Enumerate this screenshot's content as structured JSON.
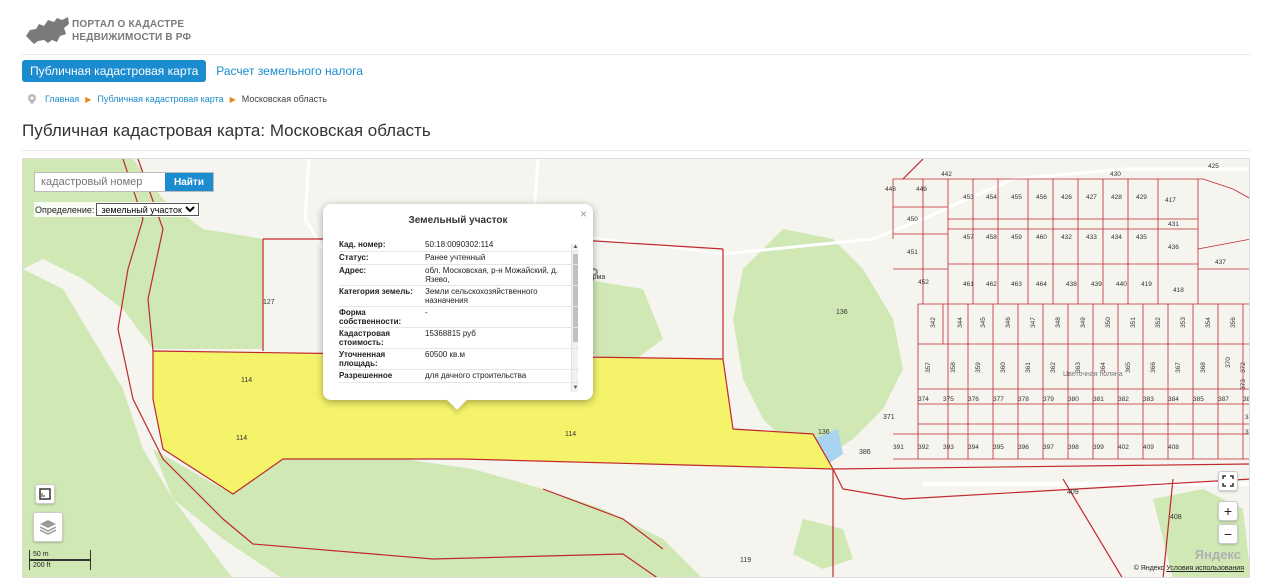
{
  "header": {
    "logo_line1": "ПОРТАЛ О КАДАСТРЕ",
    "logo_line2": "НЕДВИЖИМОСТИ В РФ",
    "tab_active": "Публичная кадастровая карта",
    "tab_other": "Расчет земельного налога"
  },
  "breadcrumbs": [
    "Главная",
    "Публичная кадастровая карта",
    "Московская область"
  ],
  "page_title": "Публичная кадастровая карта: Московская область",
  "map": {
    "search_placeholder": "кадастровый номер",
    "search_button": "Найти",
    "definition_label": "Определение:",
    "definition_value": "земельный участок",
    "scale_m": "50 m",
    "scale_ft": "200 ft",
    "copyright": "© Яндекс",
    "terms": "Условия использования",
    "brand": "Яндекс",
    "poi_label": "ферма",
    "area_label": "Цветочная поляна",
    "zoom_in": "+",
    "zoom_out": "−",
    "parcel_labels": [
      "127",
      "114",
      "114",
      "114",
      "136",
      "136",
      "119",
      "409",
      "408",
      "386",
      "371"
    ],
    "lot_numbers": [
      "448",
      "449",
      "453",
      "454",
      "455",
      "456",
      "426",
      "427",
      "428",
      "429",
      "417",
      "425",
      "430",
      "442",
      "450",
      "457",
      "458",
      "459",
      "460",
      "432",
      "433",
      "434",
      "435",
      "431",
      "436",
      "437",
      "451",
      "452",
      "461",
      "462",
      "463",
      "464",
      "438",
      "439",
      "440",
      "419",
      "418",
      "342",
      "344",
      "345",
      "346",
      "347",
      "348",
      "349",
      "350",
      "351",
      "352",
      "353",
      "354",
      "356",
      "357",
      "358",
      "359",
      "360",
      "361",
      "362",
      "363",
      "364",
      "365",
      "366",
      "367",
      "368",
      "370",
      "372",
      "373",
      "374",
      "375",
      "376",
      "377",
      "378",
      "379",
      "380",
      "381",
      "382",
      "383",
      "384",
      "385",
      "387",
      "388",
      "389",
      "390",
      "391",
      "392",
      "393",
      "394",
      "395",
      "396",
      "397",
      "398",
      "399",
      "402",
      "409",
      "408"
    ]
  },
  "popup": {
    "title": "Земельный участок",
    "close": "×",
    "rows": [
      {
        "k": "Кад. номер:",
        "v": "50:18:0090302:114"
      },
      {
        "k": "Статус:",
        "v": "Ранее учтенный"
      },
      {
        "k": "Адрес:",
        "v": "обл. Московская, р-н Можайский, д. Язево,"
      },
      {
        "k": "Категория земель:",
        "v": "Земли сельскохозяйственного назначения"
      },
      {
        "k": "Форма собственности:",
        "v": "-"
      },
      {
        "k": "Кадастровая стоимость:",
        "v": "15368815 руб"
      },
      {
        "k": "Уточненная площадь:",
        "v": "60500 кв.м"
      },
      {
        "k": "Разрешенное",
        "v": "для дачного строительства"
      }
    ]
  },
  "colors": {
    "accent": "#1a8ccf",
    "parcel_border": "#c0282d",
    "selected_fill": "#f5f36a",
    "forest": "#cfe8b4",
    "crumb_sep": "#e08a1e"
  }
}
